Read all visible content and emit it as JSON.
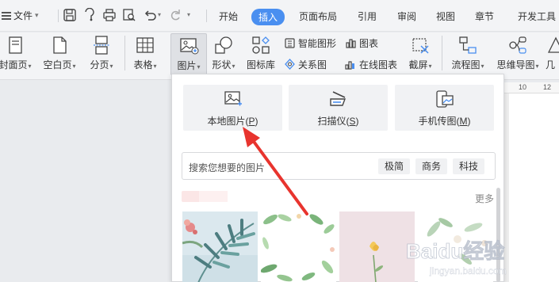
{
  "menubar": {
    "file_label": "文件",
    "tabs": [
      "开始",
      "插入",
      "页面布局",
      "引用",
      "审阅",
      "视图",
      "章节",
      "开发工具"
    ],
    "active_tab": "插入"
  },
  "ribbon": {
    "cover_page": "封面页",
    "blank_page": "空白页",
    "page_break": "分页",
    "table": "表格",
    "picture": "图片",
    "shapes": "形状",
    "icon_library": "图标库",
    "smart_graphic": "智能图形",
    "chart": "图表",
    "relation_chart": "关系图",
    "online_chart": "在线图表",
    "screenshot": "截屏",
    "flowchart": "流程图",
    "mindmap": "思维导图",
    "geometry": "几"
  },
  "ruler": {
    "ticks": [
      "10",
      "12"
    ]
  },
  "picture_panel": {
    "local_picture": {
      "text": "本地图片",
      "key": "P"
    },
    "scanner": {
      "text": "扫描仪",
      "key": "S"
    },
    "phone_picture": {
      "text": "手机传图",
      "key": "M"
    },
    "search_placeholder": "搜索您想要的图片",
    "filters": [
      "极简",
      "商务",
      "科技"
    ],
    "more_label": "更多"
  },
  "watermark": {
    "logo": "Baidu经验",
    "url": "jingyan.baidu.com"
  },
  "colors": {
    "accent": "#4a8ff0",
    "arrow": "#e8342e",
    "panel_bg": "#ffffff",
    "tile_bg": "#f1f2f4"
  }
}
